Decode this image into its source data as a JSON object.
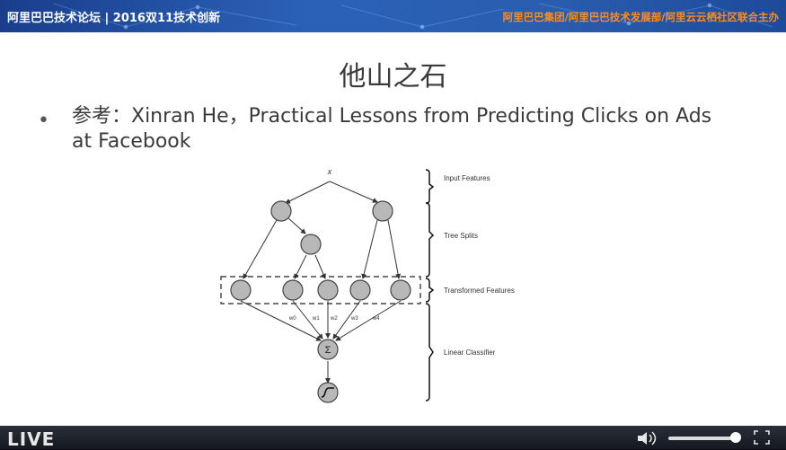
{
  "header": {
    "title": "阿里巴巴技术论坛 | 2016双11技术创新",
    "organizers": "阿里巴巴集团/阿里巴巴技术发展部/阿里云云栖社区联合主办",
    "accent_color": "#ff8c1a"
  },
  "slide": {
    "title": "他山之石",
    "bullet": "参考：Xinran He，Practical Lessons from Predicting Clicks on Ads at Facebook"
  },
  "diagram": {
    "input_label": "x",
    "bracket_labels": [
      "Input Features",
      "Tree Splits",
      "Transformed Features",
      "Linear Classifier"
    ],
    "weight_labels": [
      "w0",
      "w1",
      "w2",
      "w3",
      "w4"
    ],
    "sum_symbol": "Σ"
  },
  "player": {
    "live_label": "LIVE",
    "volume_level": 0.9,
    "icons": [
      "volume-icon",
      "fullscreen-icon"
    ]
  }
}
